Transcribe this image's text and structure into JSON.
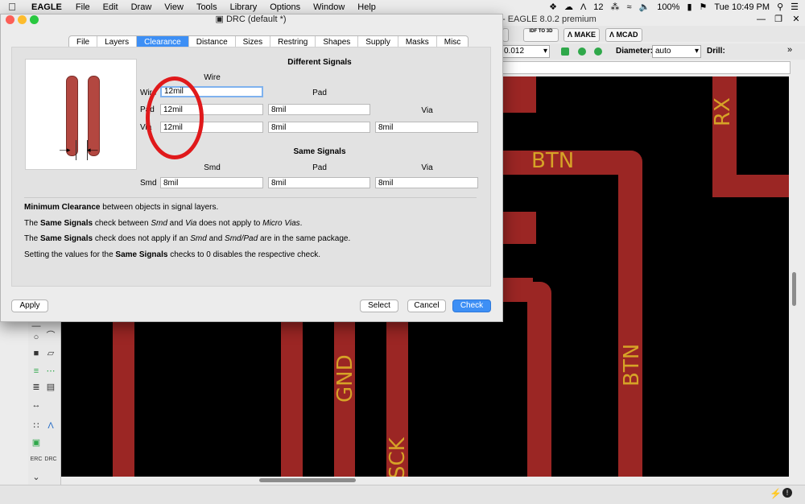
{
  "menubar": {
    "app": "EAGLE",
    "items": [
      "File",
      "Edit",
      "Draw",
      "View",
      "Tools",
      "Library",
      "Options",
      "Window",
      "Help"
    ],
    "status": {
      "notify_count": "12",
      "battery": "100%",
      "clock": "Tue 10:49 PM"
    }
  },
  "main_window": {
    "title": "- EAGLE 8.0.2 premium",
    "toolbar": {
      "idf_label": "IDF TO 3D",
      "make_label": "MAKE",
      "mcad_label": "MCAD"
    },
    "width_value": "0.012",
    "diameter_label": "Diameter:",
    "diameter_value": "auto",
    "drill_label": "Drill:"
  },
  "canvas": {
    "labels": {
      "btn_h": "BTN",
      "rx": "RX",
      "btn_v": "BTN",
      "gnd": "GND",
      "sck": "SCK"
    },
    "colors": {
      "trace": "#9b2624",
      "label": "#d6a327",
      "background": "#000000"
    }
  },
  "drc": {
    "title": "DRC (default *)",
    "tabs": [
      "File",
      "Layers",
      "Clearance",
      "Distance",
      "Sizes",
      "Restring",
      "Shapes",
      "Supply",
      "Masks",
      "Misc"
    ],
    "active_tab": "Clearance",
    "different_signals": {
      "heading": "Different Signals",
      "wire_col": "Wire",
      "pad_col": "Pad",
      "via_col": "Via",
      "rows": {
        "wire": {
          "label": "Wire",
          "wire": "12mil"
        },
        "pad": {
          "label": "Pad",
          "wire": "12mil",
          "pad": "8mil"
        },
        "via": {
          "label": "Via",
          "wire": "12mil",
          "pad": "8mil",
          "via": "8mil"
        }
      }
    },
    "same_signals": {
      "heading": "Same Signals",
      "smd_col": "Smd",
      "pad_col": "Pad",
      "via_col": "Via",
      "row_label": "Smd",
      "smd": "8mil",
      "pad": "8mil",
      "via": "8mil"
    },
    "notes": {
      "n1_b": "Minimum Clearance",
      "n1_rest": " between objects in signal layers.",
      "n2_a": "The ",
      "n2_b": "Same Signals",
      "n2_c": " check between ",
      "n2_d": "Smd",
      "n2_e": " and ",
      "n2_f": "Via",
      "n2_g": " does not apply to ",
      "n2_h": "Micro Vias",
      "n2_i": ".",
      "n3_a": "The ",
      "n3_b": "Same Signals",
      "n3_c": " check does not apply if an ",
      "n3_d": "Smd",
      "n3_e": " and ",
      "n3_f": "Smd/Pad",
      "n3_g": " are in the same package.",
      "n4_a": "Setting the values for the ",
      "n4_b": "Same Signals",
      "n4_c": " checks to 0 disables the respective check."
    },
    "buttons": {
      "apply": "Apply",
      "select": "Select",
      "cancel": "Cancel",
      "check": "Check"
    },
    "annotation_color": "#e0191b"
  }
}
